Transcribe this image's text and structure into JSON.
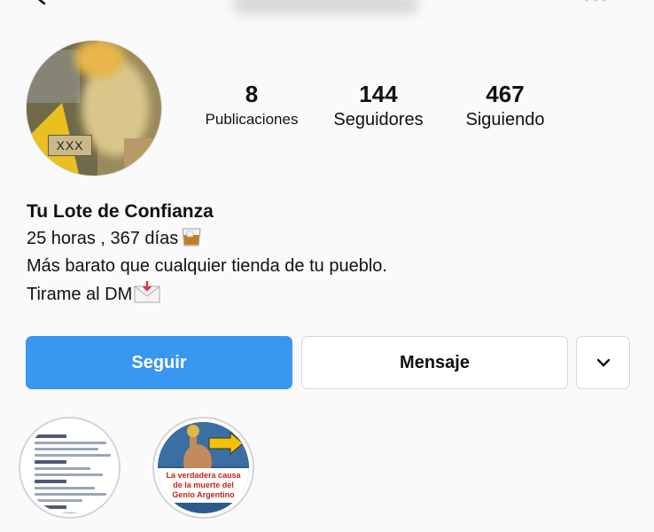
{
  "header": {
    "back_icon": "back-arrow-icon",
    "menu_icon": "more-options-icon"
  },
  "profile": {
    "avatar_tag": "XXX",
    "stats": {
      "posts_count": "8",
      "posts_label": "Publicaciones",
      "followers_count": "144",
      "followers_label": "Seguidores",
      "following_count": "467",
      "following_label": "Siguiendo"
    },
    "bio": {
      "name": "Tu Lote de Confianza",
      "line1": "25 horas , 367 días",
      "line1_emoji": "whisky-glass-icon",
      "line2": "Más barato que cualquier tienda de tu pueblo.",
      "line3": "Tirame al DM",
      "line3_emoji": "envelope-icon"
    }
  },
  "actions": {
    "follow_label": "Seguir",
    "message_label": "Mensaje",
    "more_icon": "chevron-down-icon"
  },
  "highlights": [
    {
      "label": "",
      "cover": "document-thumbnail"
    },
    {
      "label": "",
      "cover_caption": "La verdadera causa de la muerte del Genio Argentino"
    }
  ],
  "colors": {
    "follow_button": "#3897f0",
    "border": "#d6d6d6",
    "background": "#fafafa"
  }
}
